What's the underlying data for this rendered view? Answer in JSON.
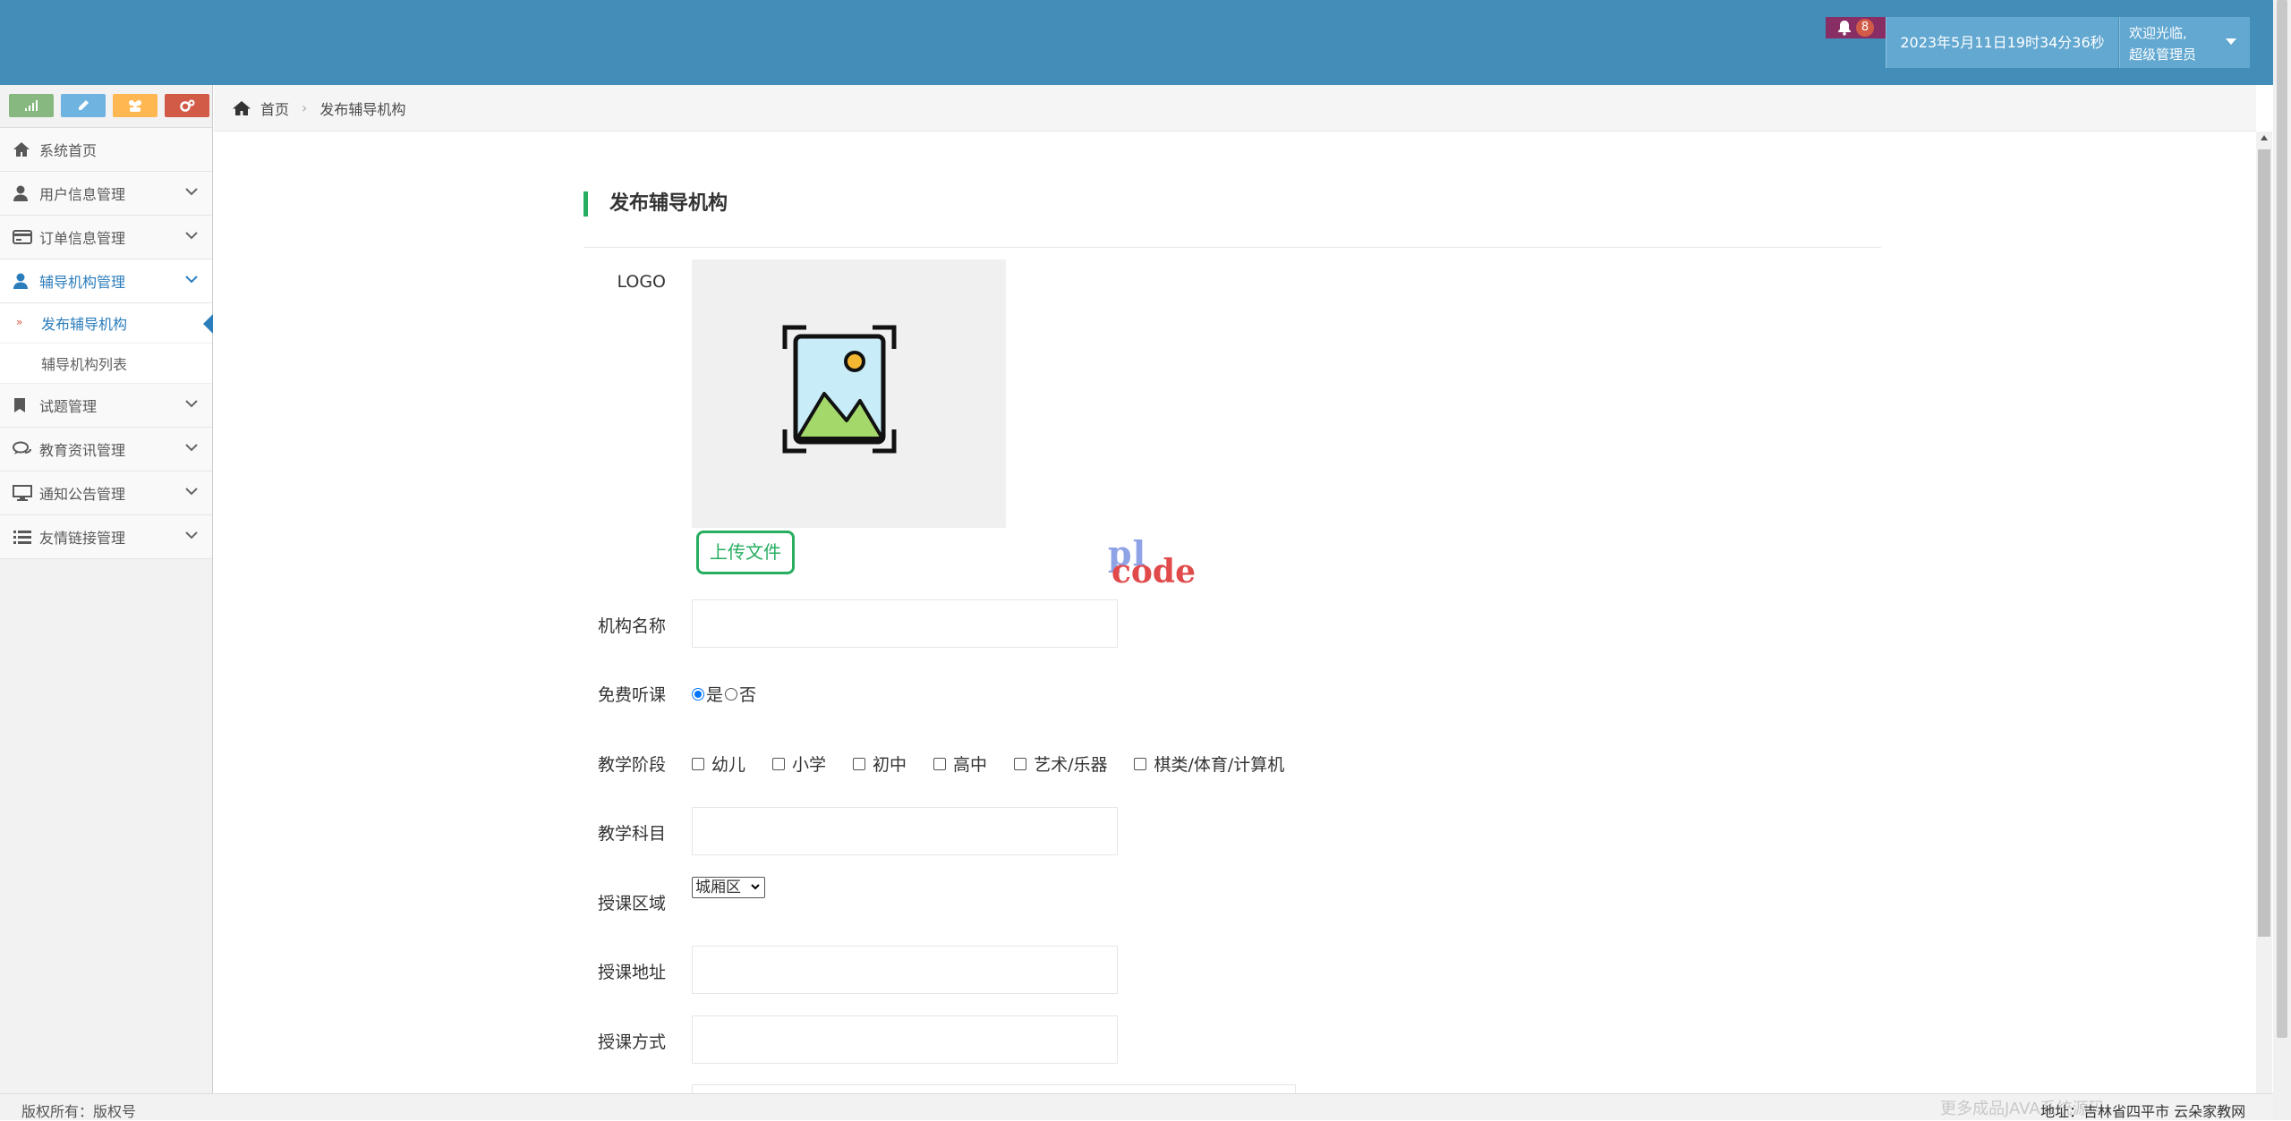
{
  "header": {
    "notification_count": "8",
    "datetime": "2023年5月11日19时34分36秒",
    "welcome": "欢迎光临,",
    "role": "超级管理员",
    "colors": {
      "bar": "#438eb9",
      "bell_bg": "#892e65",
      "info_bg": "#62a8d1"
    }
  },
  "shortcuts": [
    {
      "icon": "signal-icon",
      "color": "#87b87f"
    },
    {
      "icon": "pencil-icon",
      "color": "#6fb3e0"
    },
    {
      "icon": "users-icon",
      "color": "#ffb752"
    },
    {
      "icon": "cogs-icon",
      "color": "#d15b47"
    }
  ],
  "sidebar": {
    "items": [
      {
        "label": "系统首页",
        "icon": "home-icon"
      },
      {
        "label": "用户信息管理",
        "icon": "user-icon"
      },
      {
        "label": "订单信息管理",
        "icon": "card-icon"
      },
      {
        "label": "辅导机构管理",
        "icon": "user-icon"
      },
      {
        "label": "试题管理",
        "icon": "bookmark-icon"
      },
      {
        "label": "教育资讯管理",
        "icon": "comments-icon"
      },
      {
        "label": "通知公告管理",
        "icon": "desktop-icon"
      },
      {
        "label": "友情链接管理",
        "icon": "list-icon"
      }
    ],
    "sub_items": [
      {
        "label": "发布辅导机构"
      },
      {
        "label": "辅导机构列表"
      }
    ]
  },
  "breadcrumb": {
    "home": "首页",
    "current": "发布辅导机构"
  },
  "form": {
    "title": "发布辅导机构",
    "logo_label": "LOGO",
    "upload_label": "上传文件",
    "name_label": "机构名称",
    "name_value": "",
    "free_label": "免费听课",
    "free_options": [
      "是",
      "否"
    ],
    "free_selected": "是",
    "stage_label": "教学阶段",
    "stage_options": [
      "幼儿",
      "小学",
      "初中",
      "高中",
      "艺术/乐器",
      "棋类/体育/计算机"
    ],
    "subject_label": "教学科目",
    "subject_value": "",
    "area_label": "授课区域",
    "area_selected": "城厢区",
    "address_label": "授课地址",
    "address_value": "",
    "mode_label": "授课方式",
    "mode_value": ""
  },
  "watermark": {
    "line1": "pl",
    "line2": "code",
    "ghost": "更多成品JAVA系统源码"
  },
  "footer": {
    "copyright": "版权所有：版权号",
    "address": "地址：吉林省四平市  云朵家教网"
  }
}
